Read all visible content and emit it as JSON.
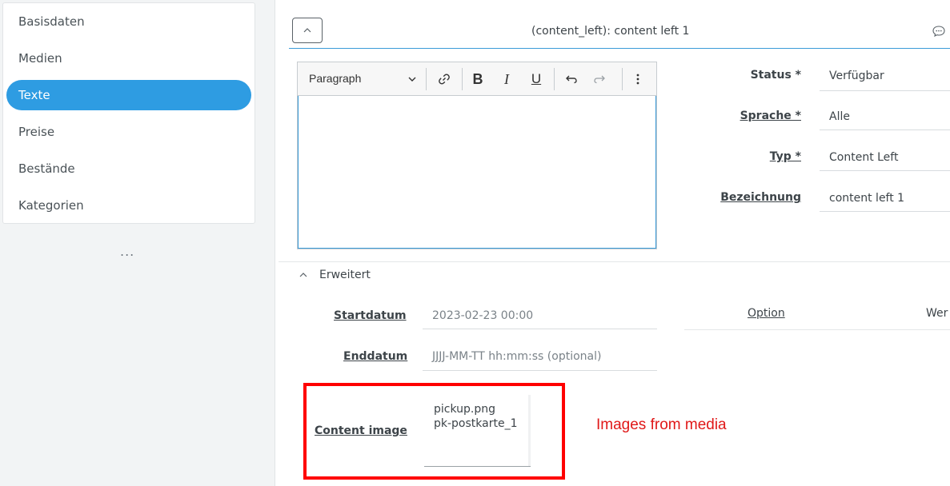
{
  "sidebar": {
    "items": [
      {
        "label": "Basisdaten",
        "active": false
      },
      {
        "label": "Medien",
        "active": false
      },
      {
        "label": "Texte",
        "active": true
      },
      {
        "label": "Preise",
        "active": false
      },
      {
        "label": "Bestände",
        "active": false
      },
      {
        "label": "Kategorien",
        "active": false
      }
    ],
    "more_label": "..."
  },
  "header": {
    "collapse_icon": "chevron-up-icon",
    "title": "(content_left): content left 1",
    "comment_icon": "comment-icon"
  },
  "editor": {
    "paragraph_select": "Paragraph",
    "bold_label": "B",
    "italic_label": "I",
    "underline_label": "U",
    "content": ""
  },
  "form": {
    "status_label": "Status *",
    "status_value": "Verfügbar",
    "sprache_label": "Sprache *",
    "sprache_value": "Alle",
    "typ_label": "Typ *",
    "typ_value": "Content Left",
    "bezeichnung_label": "Bezeichnung",
    "bezeichnung_value": "content left 1"
  },
  "extended": {
    "header": "Erweitert",
    "startdatum_label": "Startdatum",
    "startdatum_value": "2023-02-23 00:00",
    "enddatum_label": "Enddatum",
    "enddatum_placeholder": "JJJJ-MM-TT hh:mm:ss (optional)",
    "option_label": "Option",
    "wert_label": "Wer",
    "content_image_label": "Content image",
    "content_images": [
      "pickup.png",
      "pk-postkarte_1"
    ]
  },
  "annotation": "Images from media",
  "colors": {
    "accent": "#2e9ce2",
    "highlight_box": "#ff0000",
    "annotation_text": "#e01818"
  }
}
